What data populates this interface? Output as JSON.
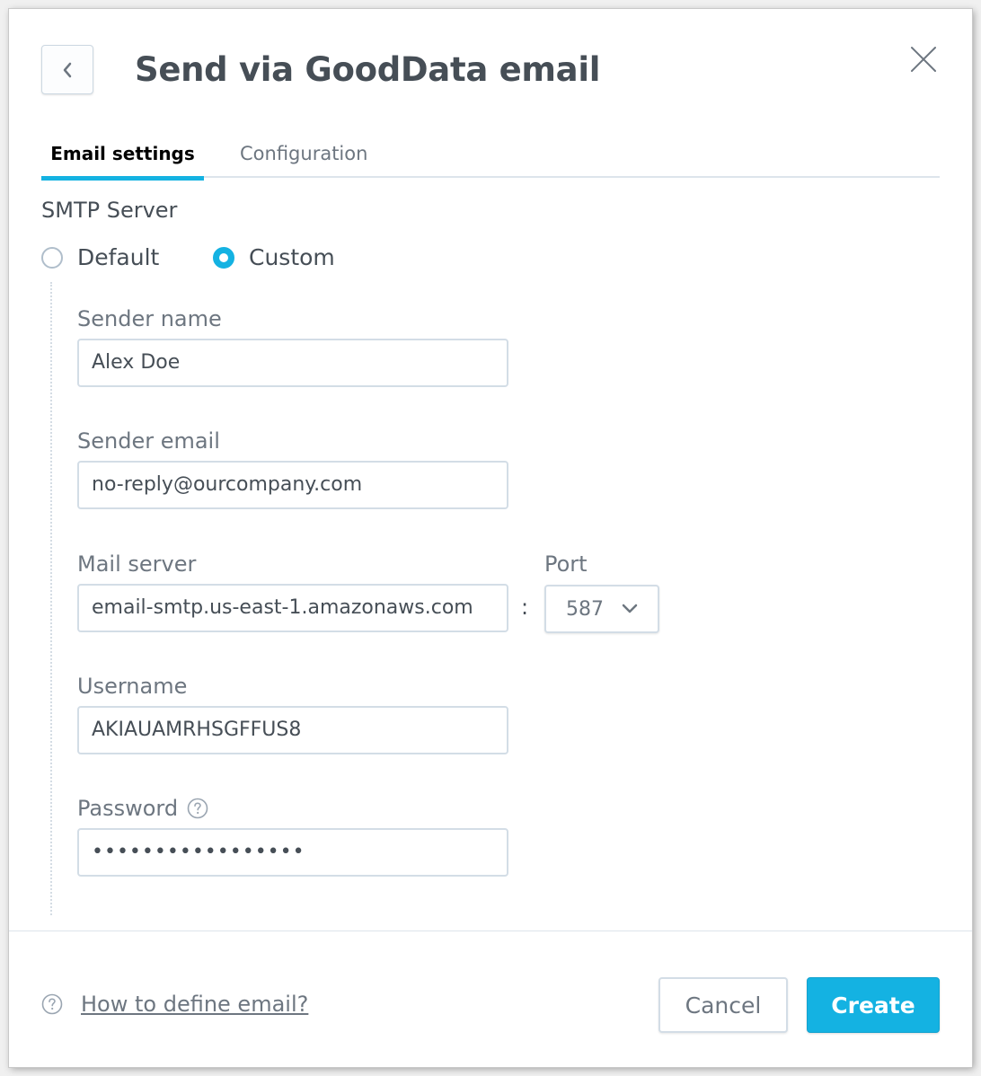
{
  "dialog": {
    "title": "Send via GoodData email",
    "back_icon": "chevron-left-icon",
    "close_icon": "close-icon"
  },
  "tabs": [
    {
      "label": "Email settings",
      "active": true
    },
    {
      "label": "Configuration",
      "active": false
    }
  ],
  "smtp": {
    "label": "SMTP Server",
    "options": [
      {
        "label": "Default",
        "selected": false
      },
      {
        "label": "Custom",
        "selected": true
      }
    ]
  },
  "fields": {
    "sender_name": {
      "label": "Sender name",
      "value": "Alex Doe"
    },
    "sender_email": {
      "label": "Sender email",
      "value": "no-reply@ourcompany.com"
    },
    "mail_server": {
      "label": "Mail server",
      "value": "email-smtp.us-east-1.amazonaws.com"
    },
    "separator": ":",
    "port": {
      "label": "Port",
      "value": "587"
    },
    "username": {
      "label": "Username",
      "value": "AKIAUAMRHSGFFUS8"
    },
    "password": {
      "label": "Password",
      "value": "•••••••••••••••••",
      "help_icon": "question-circle-icon"
    }
  },
  "footer": {
    "help_link": "How to define email?",
    "cancel_label": "Cancel",
    "create_label": "Create"
  },
  "colors": {
    "accent": "#14b2e2",
    "text": "#464e56",
    "muted": "#6d7680"
  }
}
